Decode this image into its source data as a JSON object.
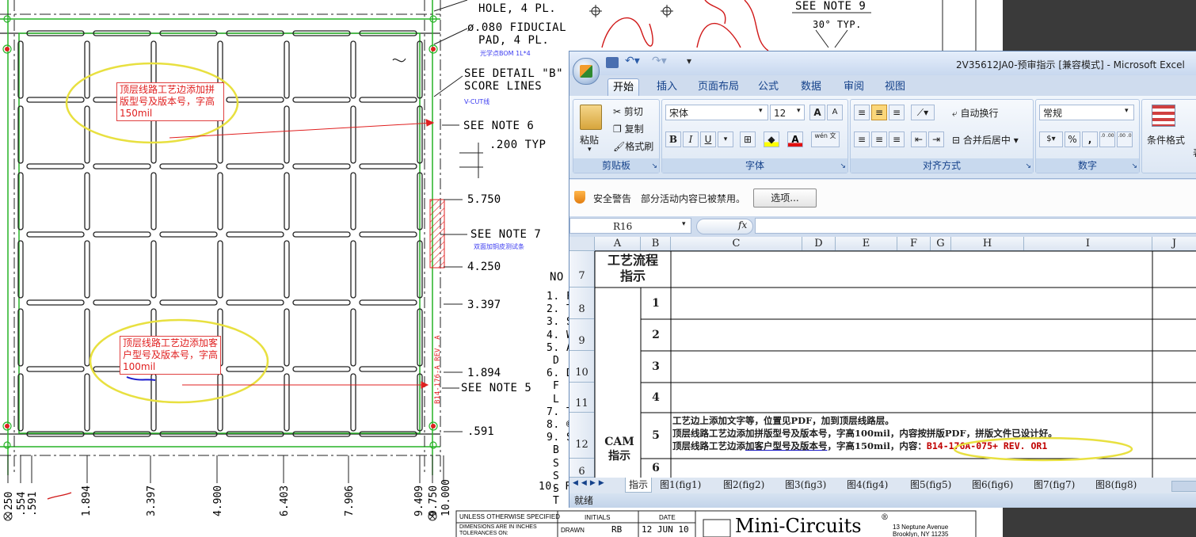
{
  "drawing": {
    "hole_label": "HOLE, 4 PL.",
    "fiducial_line1": "ø.080 FIDUCIAL",
    "fiducial_line2": "PAD, 4 PL.",
    "fiducial_note_cn": "光学点BOM 1L*4",
    "detail_line1": "SEE DETAIL \"B\"",
    "detail_line2": "SCORE LINES",
    "vcut_note": "V-CUT线",
    "note6": "SEE NOTE 6",
    "typ200": ".200 TYP",
    "dim_5750": "5.750",
    "note7": "SEE NOTE 7",
    "note7_cn": "双面加铜皮测试条",
    "dim_4250": "4.250",
    "dim_3397": "3.397",
    "dim_1894": "1.894",
    "note5": "SEE NOTE 5",
    "dim_591": ".591",
    "see_note9": "SEE NOTE 9",
    "typ30": "30° TYP.",
    "vertical_mark": "B14-176-A  REV. A",
    "bottom_dims": [
      ".250",
      ".554",
      ".591",
      "1.894",
      "3.397",
      "4.900",
      "6.403",
      "7.906",
      "9.409",
      "9.750",
      "10.000"
    ],
    "notes_heading": "NO",
    "notes_left": [
      "1. F",
      "2. T",
      "3. S",
      "4. W",
      "5. A",
      "D",
      "6. D",
      "F",
      "L",
      "7. T",
      "8. ©",
      "9. S",
      "B",
      "S",
      "S",
      "S",
      "10. F",
      "T"
    ],
    "annotation_top": "顶层线路工艺边添加拼版型号及版本号，字高150mil",
    "annotation_bottom": "顶层线路工艺边添加客户型号及版本号，字高100mil",
    "title_block": {
      "unless": "UNLESS OTHERWISE SPECIFIED",
      "dimensions": "DIMENSIONS ARE IN INCHES",
      "tolerances": "TOLERANCES ON:",
      "initials": "INITIALS",
      "date": "DATE",
      "drawn": "DRAWN",
      "drawn_by": "RB",
      "drawn_date": "12 JUN 10",
      "company": "Mini-Circuits",
      "registered": "®",
      "address1": "13 Neptune Avenue",
      "address2": "Brooklyn, NY 11235"
    }
  },
  "excel": {
    "window_title": "2V35612JA0-预审指示 [兼容模式] - Microsoft Excel",
    "tabs": [
      "开始",
      "插入",
      "页面布局",
      "公式",
      "数据",
      "审阅",
      "视图"
    ],
    "clipboard": {
      "paste": "粘贴",
      "cut": "剪切",
      "copy": "复制",
      "format_painter": "格式刷",
      "label": "剪贴板"
    },
    "font": {
      "name": "宋体",
      "size": "12",
      "label": "字体",
      "bold": "B",
      "italic": "I",
      "underline": "U",
      "grow": "A",
      "shrink": "A",
      "font_color": "A",
      "wen": "wén 文"
    },
    "alignment": {
      "wrap": "自动换行",
      "merge": "合并后居中",
      "label": "对齐方式"
    },
    "number": {
      "format": "常规",
      "percent": "%",
      "comma": ",",
      "inc": ".0 .00",
      "dec": ".00 .0",
      "label": "数字"
    },
    "styles": {
      "conditional": "条件格式",
      "label": "表"
    },
    "security": {
      "warning": "安全警告",
      "message": "部分活动内容已被禁用。",
      "options": "选项..."
    },
    "name_box": "R16",
    "fx": "fx",
    "columns": [
      "A",
      "B",
      "C",
      "D",
      "E",
      "F",
      "G",
      "H",
      "I",
      "J"
    ],
    "rows": [
      "7",
      "8",
      "9",
      "10",
      "11",
      "12",
      "6"
    ],
    "process_header_1": "工艺流程",
    "process_header_2": "指示",
    "step_numbers": [
      "1",
      "2",
      "3",
      "4",
      "5",
      "6"
    ],
    "cam_1": "CAM",
    "cam_2": "指示",
    "step5_line1": "工艺边上添加文字等，位置见PDF，加到顶层线路层。",
    "step5_line2": "顶层线路工艺边添加拼版型号及版本号，字高100mil，内容按拼版PDF，拼版文件已设计好。",
    "step5_line3_a": "顶层线路工艺边添",
    "step5_line3_b": "加客户型号及版本号",
    "step5_line3_c": "，字高150mil，内容：",
    "step5_value": "B14-176A-075+ REV. OR1",
    "sheet_tabs": [
      "指示",
      "图1(fig1)",
      "图2(fig2)",
      "图3(fig3)",
      "图4(fig4)",
      "图5(fig5)",
      "图6(fig6)",
      "图7(fig7)",
      "图8(fig8)"
    ],
    "status": "就绪",
    "colors": {
      "accent": "#15428b",
      "ribbon": "#dbe6f4",
      "highlight": "#e8e040",
      "red_text": "#c00000"
    }
  }
}
